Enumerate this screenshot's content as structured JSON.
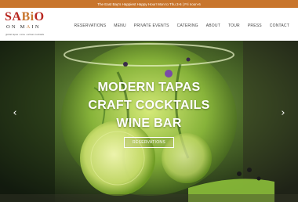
{
  "announcement": "The East Bay's Happiest Happy Hour! Mon to Thu 3-6 | Fri noon-6",
  "brand": {
    "logo_main_a": "SA",
    "logo_main_b": "Bi",
    "logo_main_c": "O",
    "logo_sub_a": "ON M",
    "logo_sub_b": "A",
    "logo_sub_c": "IN",
    "tagline": "global tapas • wine • artisan cocktails",
    "colors": {
      "red": "#b8261f",
      "orange": "#c8752c"
    }
  },
  "nav": [
    {
      "label": "RESERVATIONS"
    },
    {
      "label": "MENU"
    },
    {
      "label": "PRIVATE EVENTS"
    },
    {
      "label": "CATERING"
    },
    {
      "label": "ABOUT"
    },
    {
      "label": "TOUR"
    },
    {
      "label": "PRESS"
    },
    {
      "label": "CONTACT"
    }
  ],
  "hero": {
    "lines": [
      "MODERN TAPAS",
      "CRAFT COCKTAILS",
      "WINE BAR"
    ],
    "cta_label": "RESERVATIONS",
    "prev_icon": "chevron-left-icon",
    "next_icon": "chevron-right-icon"
  }
}
